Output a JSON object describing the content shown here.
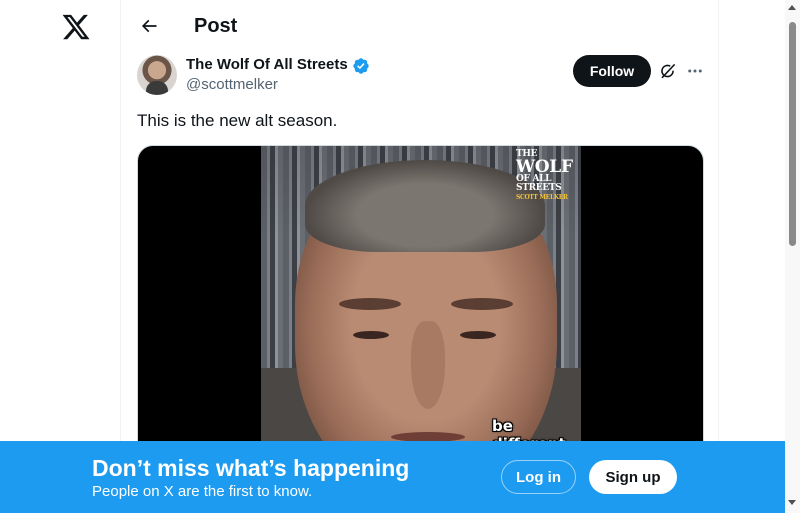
{
  "header": {
    "title": "Post",
    "back_icon": "arrow-left-icon",
    "logo_icon": "x-logo-icon"
  },
  "author": {
    "name": "The Wolf Of All Streets",
    "handle": "@scottmelker",
    "verified": true,
    "verified_color": "#1d9bf0"
  },
  "actions": {
    "follow_label": "Follow",
    "grok_icon": "grok-icon",
    "more_icon": "more-horizontal-icon"
  },
  "post": {
    "text": "This is the new alt season.",
    "video": {
      "watermark_line1": "THE",
      "watermark_line2": "WOLF",
      "watermark_line3": "OF ALL STREETS",
      "watermark_line4": "SCOTT MELKER",
      "caption": "be different"
    }
  },
  "banner": {
    "title": "Don’t miss what’s happening",
    "subtitle": "People on X are the first to know.",
    "login_label": "Log in",
    "signup_label": "Sign up",
    "background_color": "#1d9bf0"
  },
  "colors": {
    "text_primary": "#0f1419",
    "text_secondary": "#536471",
    "border": "#eff3f4"
  }
}
